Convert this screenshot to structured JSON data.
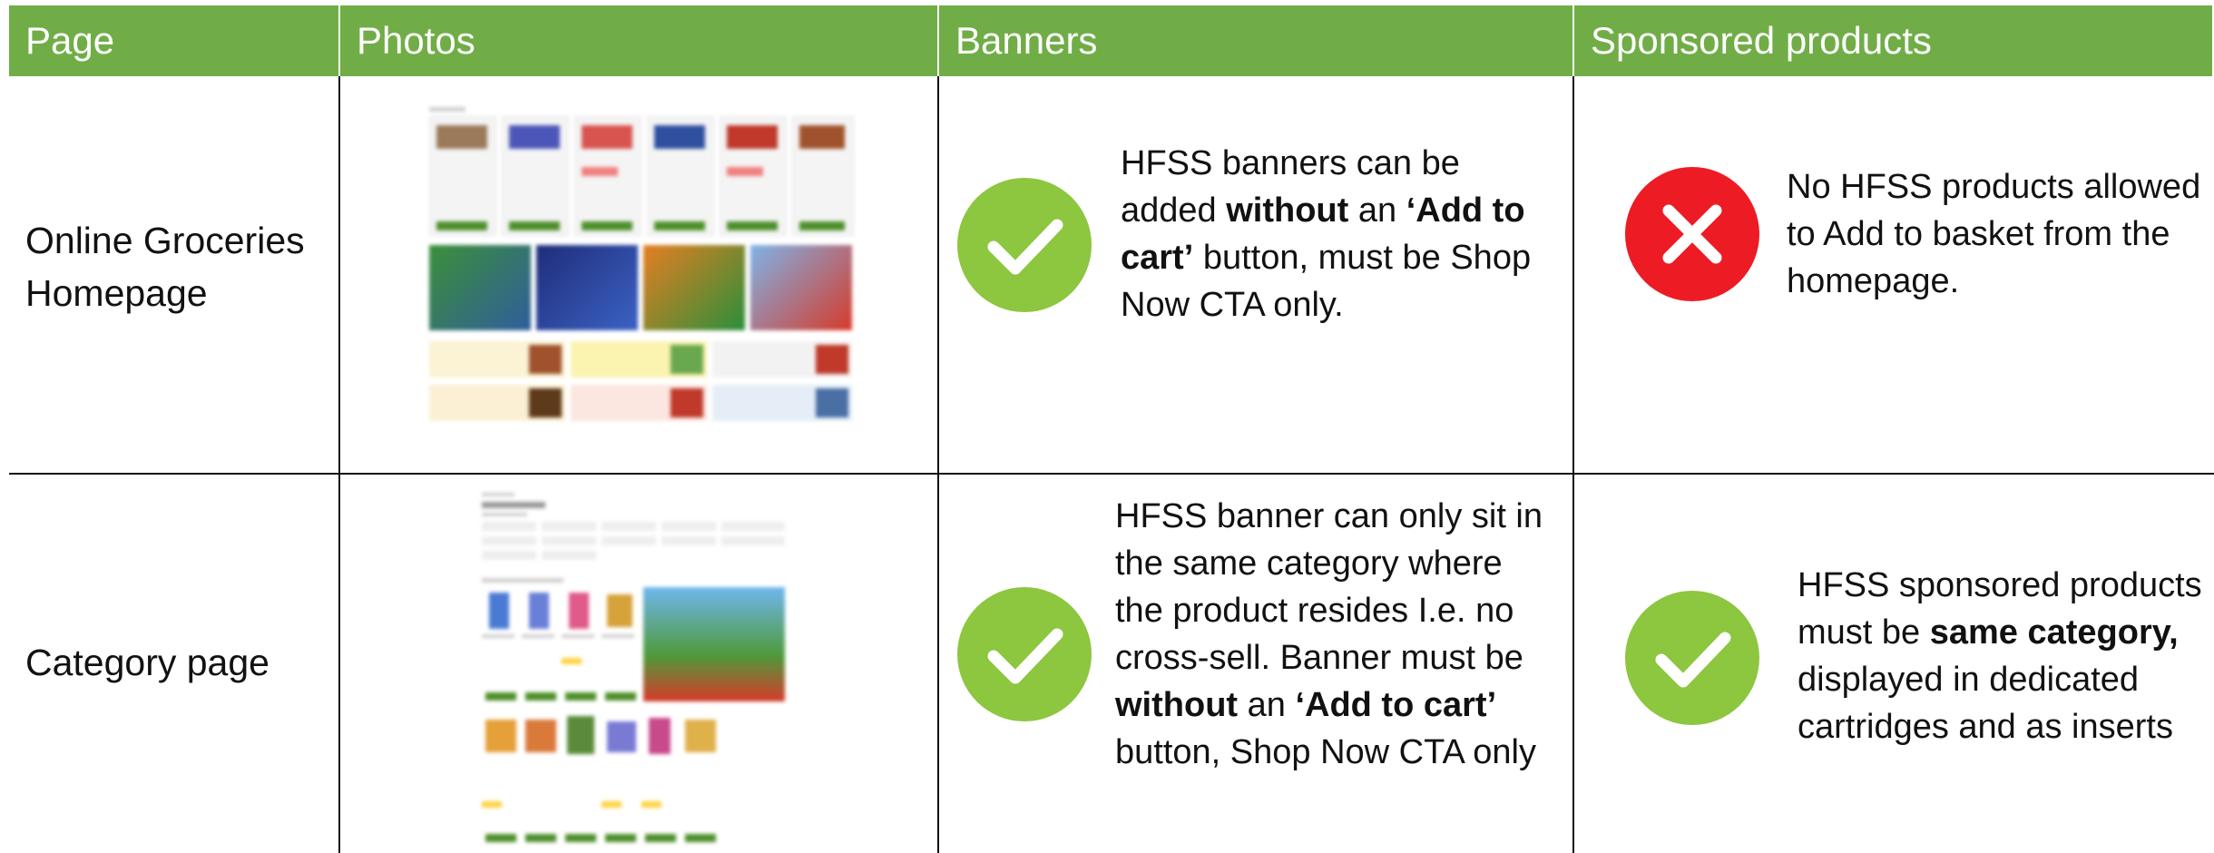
{
  "table": {
    "headers": [
      "Page",
      "Photos",
      "Banners",
      "Sponsored products"
    ],
    "rows": [
      {
        "page": "Online Groceries Homepage",
        "photo": "homepage-screenshot",
        "banner_status": "allowed",
        "banner_text": {
          "p1": "HFSS banners can be added ",
          "b1": "without",
          "p2": " an ",
          "b2": "‘Add to cart’",
          "p3": " button, must be Shop Now CTA only."
        },
        "sponsored_status": "not-allowed",
        "sponsored_text": "No HFSS products allowed to Add to basket from the homepage."
      },
      {
        "page": "Category page",
        "photo": "category-page-screenshot",
        "banner_status": "allowed",
        "banner_text": {
          "p1": "HFSS banner can only sit in the same category where the product resides I.e. no cross-sell. Banner must be ",
          "b1": "without",
          "p2": " an ",
          "b2": "‘Add to cart’",
          "p3": " button, Shop Now CTA only"
        },
        "sponsored_status": "allowed",
        "sponsored_text": {
          "p1": "HFSS sponsored products must be ",
          "b1": "same category,",
          "p2": " displayed in dedicated cartridges and as inserts"
        }
      }
    ]
  },
  "colors": {
    "header_bg": "#70ad47",
    "check": "#8dc63f",
    "cross": "#ed1c24"
  },
  "icons": {
    "allowed": "check-circle-icon",
    "not_allowed": "cross-circle-icon"
  }
}
